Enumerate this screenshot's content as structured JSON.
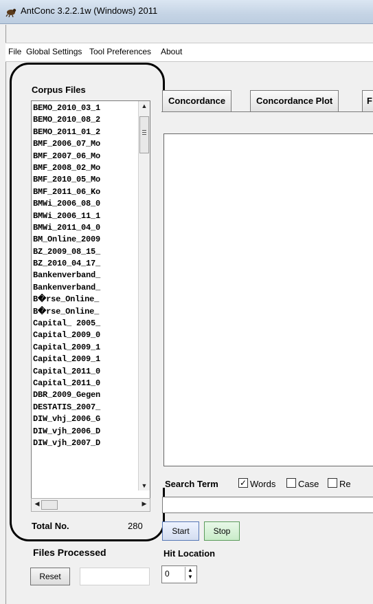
{
  "window": {
    "title": "AntConc 3.2.2.1w (Windows) 2011"
  },
  "menu": [
    "File",
    "Global Settings",
    "Tool Preferences",
    "About"
  ],
  "corpus": {
    "label": "Corpus Files",
    "files": [
      "BEMO_2010_03_1",
      "BEMO_2010_08_2",
      "BEMO_2011_01_2",
      "BMF_2006_07_Mo",
      "BMF_2007_06_Mo",
      "BMF_2008_02_Mo",
      "BMF_2010_05_Mo",
      "BMF_2011_06_Ko",
      "BMWi_2006_08_0",
      "BMWi_2006_11_1",
      "BMWi_2011_04_0",
      "BM_Online_2009",
      "BZ_2009_08_15_",
      "BZ_2010_04_17_",
      "Bankenverband_",
      "Bankenverband_",
      "B�rse_Online_",
      "B�rse_Online_",
      "Capital_ 2005_",
      "Capital_2009_0",
      "Capital_2009_1",
      "Capital_2009_1",
      "Capital_2011_0",
      "Capital_2011_0",
      "DBR_2009_Gegen",
      "DESTATIS_2007_",
      "DIW_vhj_2006_G",
      "DIW_vjh_2006_D",
      "DIW_vjh_2007_D"
    ],
    "total_label": "Total No.",
    "total_value": "280",
    "processed_label": "Files Processed",
    "reset_label": "Reset"
  },
  "tabs": [
    "Concordance",
    "Concordance Plot",
    "F"
  ],
  "search": {
    "label": "Search Term",
    "words_label": "Words",
    "words_checked": true,
    "case_label": "Case",
    "case_checked": false,
    "regex_label": "Re",
    "value": ""
  },
  "buttons": {
    "start": "Start",
    "stop": "Stop"
  },
  "hit_location": {
    "label": "Hit Location",
    "value": "0"
  },
  "icons": {
    "app": "antconc-app-icon",
    "scroll_up": "scroll-up-arrow-icon",
    "scroll_down": "scroll-down-arrow-icon",
    "scroll_left": "scroll-left-arrow-icon",
    "scroll_right": "scroll-right-arrow-icon"
  },
  "colors": {
    "annotation_frame": "#000000",
    "start_button": "#d4ddf0",
    "stop_button": "#c9ecc9"
  }
}
